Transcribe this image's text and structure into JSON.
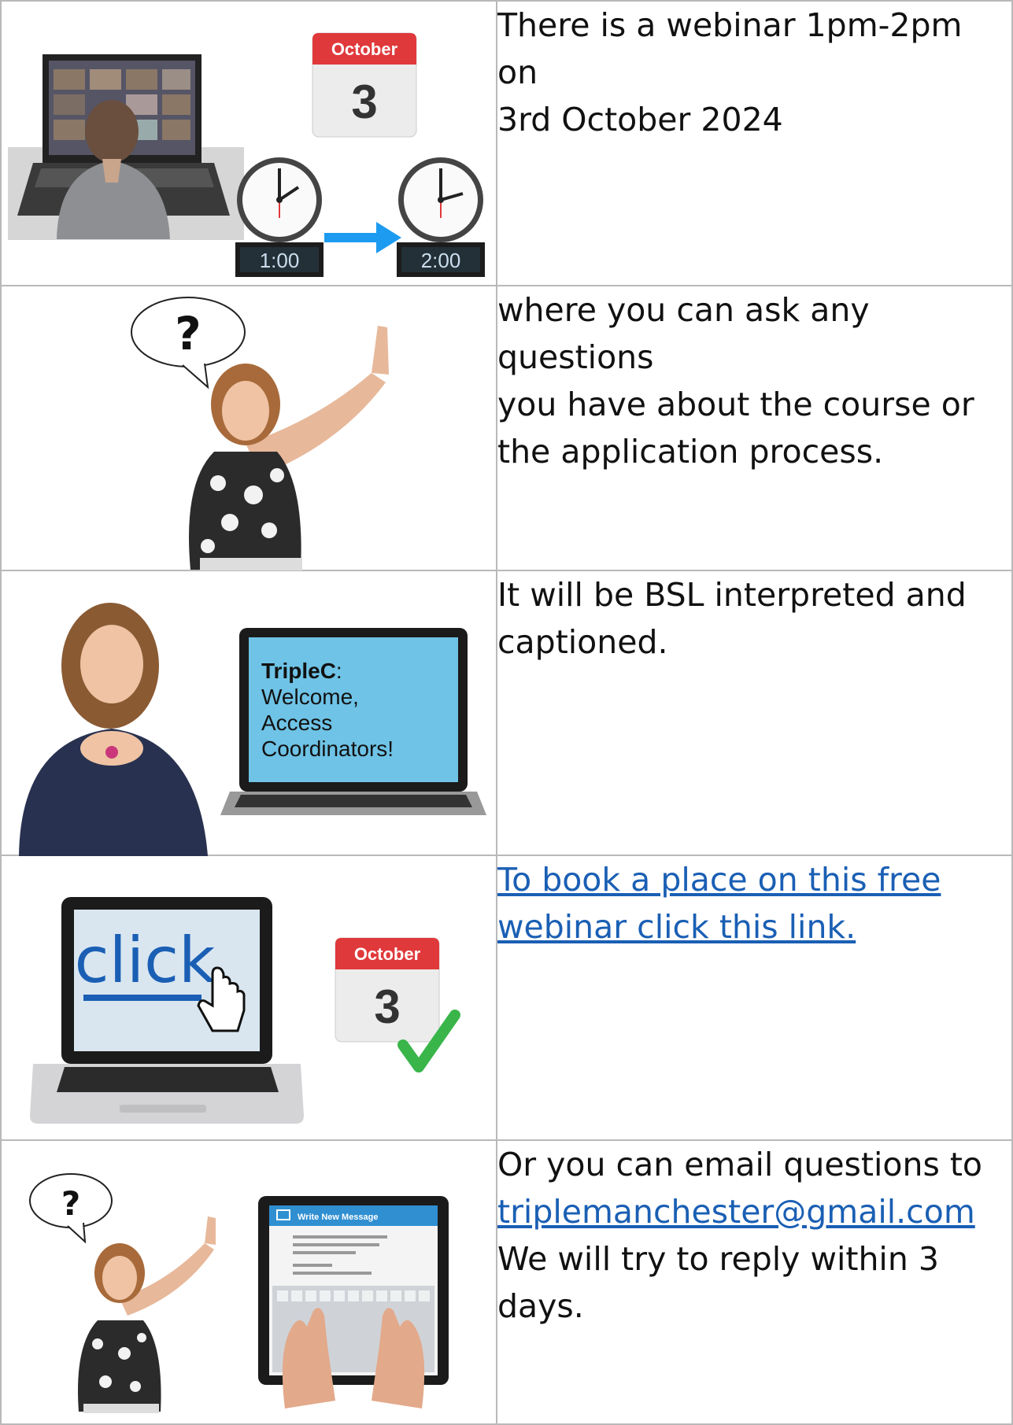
{
  "rows": [
    {
      "illustration": [
        "laptop-video-call",
        "calendar-icon",
        "clock-icon",
        "arrow-right-icon",
        "clock-icon"
      ],
      "calendar_month": "October",
      "calendar_day": "3",
      "clock_start": "1:00",
      "clock_end": "2:00",
      "text": [
        "There is a webinar 1pm-2pm on",
        "3rd October 2024"
      ]
    },
    {
      "illustration": [
        "speech-bubble-question-icon",
        "person-raising-hand"
      ],
      "question_mark": "?",
      "text": [
        "where you can ask any questions",
        "you have about the course or",
        "the application process."
      ]
    },
    {
      "illustration": [
        "person-signing-bsl",
        "laptop-captions"
      ],
      "screen_title": "TripleC",
      "screen_colon": ":",
      "screen_lines": [
        "Welcome,",
        "Access",
        "Coordinators!"
      ],
      "text": [
        "It will be BSL interpreted and",
        "captioned."
      ]
    },
    {
      "illustration": [
        "laptop-click",
        "pointer-hand-icon",
        "calendar-icon",
        "checkmark-icon"
      ],
      "screen_word": "click",
      "calendar_month": "October",
      "calendar_day": "3",
      "link_text": [
        "To book a place on this free",
        "webinar click this link."
      ]
    },
    {
      "illustration": [
        "speech-bubble-question-icon",
        "person-raising-hand",
        "tablet-email"
      ],
      "question_mark": "?",
      "tablet_header": "Write New Message",
      "text_before": "Or you can email questions to",
      "email": "triplemanchester@gmail.com",
      "text_after": "We will try to reply within 3 days."
    }
  ],
  "colors": {
    "link": "#1a5fb4",
    "calendar_red": "#e0393b",
    "arrow_blue": "#1d9bf0",
    "check_green": "#39b54a",
    "screen_blue": "#6ec3e6",
    "border": "#b9b9b9"
  }
}
